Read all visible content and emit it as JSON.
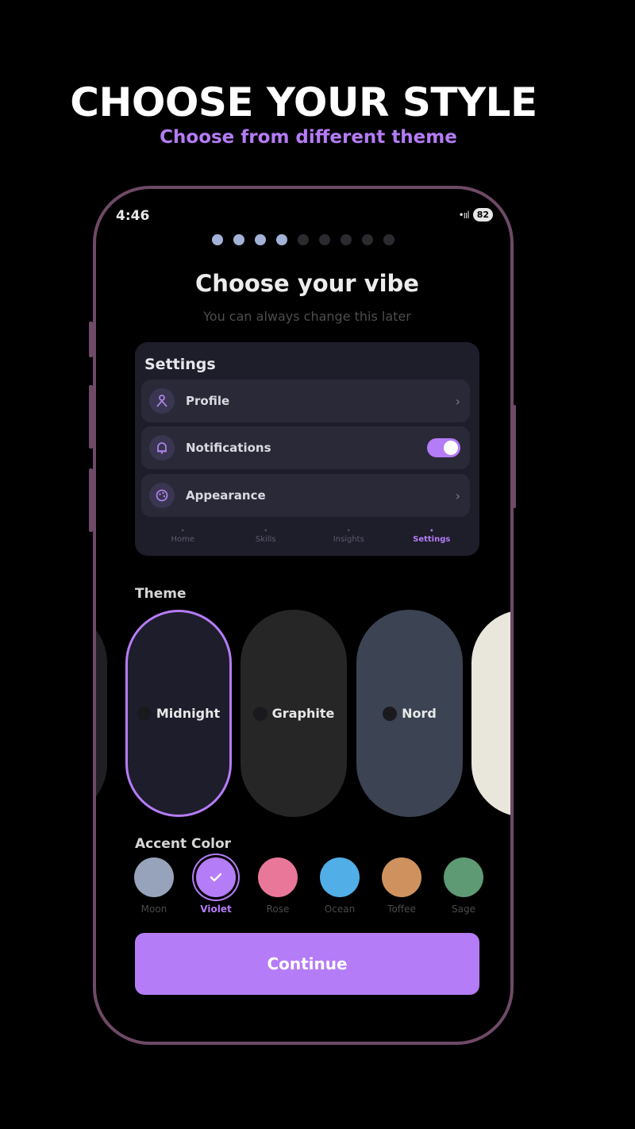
{
  "promo": {
    "headline": "CHOOSE YOUR STYLE",
    "subheadline": "Choose from different theme"
  },
  "status_bar": {
    "time": "4:46",
    "signal_icons": "•ııl",
    "battery": "82"
  },
  "progress": {
    "total_steps": 9,
    "completed_steps": 4
  },
  "screen": {
    "title": "Choose your vibe",
    "subtitle": "You can always change this later"
  },
  "preview": {
    "title": "Settings",
    "rows": [
      {
        "label": "Profile",
        "icon": "person-icon",
        "trailing": "chevron"
      },
      {
        "label": "Notifications",
        "icon": "bell-icon",
        "trailing": "toggle",
        "toggle_on": true
      },
      {
        "label": "Appearance",
        "icon": "palette-icon",
        "trailing": "chevron"
      }
    ],
    "tabs": [
      {
        "label": "Home",
        "active": false
      },
      {
        "label": "Skills",
        "active": false
      },
      {
        "label": "Insights",
        "active": false
      },
      {
        "label": "Settings",
        "active": true
      }
    ]
  },
  "theme": {
    "label": "Theme",
    "options": [
      {
        "name": "",
        "color": "#1f1f24",
        "partial": true
      },
      {
        "name": "Midnight",
        "color": "#1e1d2b",
        "selected": true
      },
      {
        "name": "Graphite",
        "color": "#262626",
        "selected": false
      },
      {
        "name": "Nord",
        "color": "#3c4353",
        "selected": false
      },
      {
        "name": "",
        "color": "#e9e6dc",
        "partial": true
      }
    ]
  },
  "accent": {
    "label": "Accent Color",
    "options": [
      {
        "name": "Moon",
        "color": "#97a3ba",
        "selected": false
      },
      {
        "name": "Violet",
        "color": "#b57cf7",
        "selected": true
      },
      {
        "name": "Rose",
        "color": "#e9779a",
        "selected": false
      },
      {
        "name": "Ocean",
        "color": "#51aee6",
        "selected": false
      },
      {
        "name": "Toffee",
        "color": "#cf925e",
        "selected": false
      },
      {
        "name": "Sage",
        "color": "#5e9a74",
        "selected": false
      }
    ]
  },
  "continue_label": "Continue",
  "colors": {
    "accent": "#b57cf7",
    "frame": "#6e4a66"
  }
}
